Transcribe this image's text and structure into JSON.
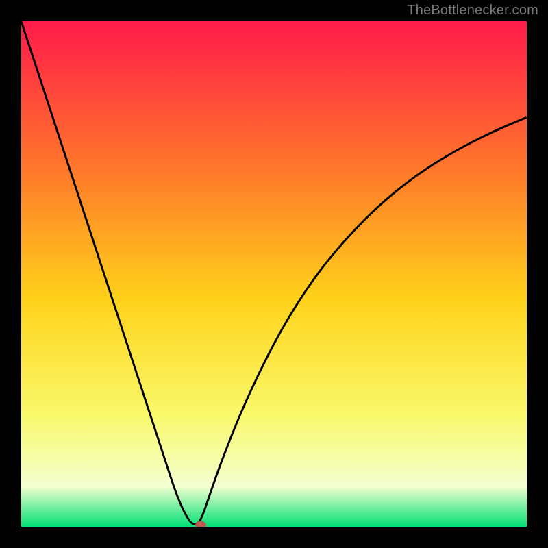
{
  "attribution": "TheBottlenecker.com",
  "colors": {
    "background": "#000000",
    "gradient_top": "#ff1a4a",
    "gradient_mid1": "#ff7a2a",
    "gradient_mid2": "#ffd21a",
    "gradient_mid3": "#f9f96b",
    "gradient_low": "#f3ffd0",
    "gradient_bottom": "#00e074",
    "curve": "#000000",
    "marker": "#c2594e"
  },
  "chart_data": {
    "type": "line",
    "title": "",
    "xlabel": "",
    "ylabel": "",
    "xlim": [
      0,
      100
    ],
    "ylim": [
      0,
      100
    ],
    "series": [
      {
        "name": "bottleneck-curve",
        "x": [
          0,
          4,
          8,
          12,
          16,
          20,
          24,
          28,
          31,
          33.5,
          35,
          36,
          37.5,
          40,
          44,
          50,
          56,
          62,
          70,
          78,
          86,
          94,
          100
        ],
        "y": [
          100,
          87.8,
          75.6,
          63.4,
          51.2,
          39.0,
          26.8,
          14.6,
          5.4,
          0.5,
          0.5,
          2.5,
          7.0,
          14.0,
          24.0,
          36.5,
          46.5,
          54.5,
          63.0,
          69.5,
          74.5,
          78.5,
          81.0
        ]
      }
    ],
    "annotations": [
      {
        "type": "marker",
        "x": 35.5,
        "y": 0.3,
        "label": "optimal-point"
      }
    ]
  }
}
